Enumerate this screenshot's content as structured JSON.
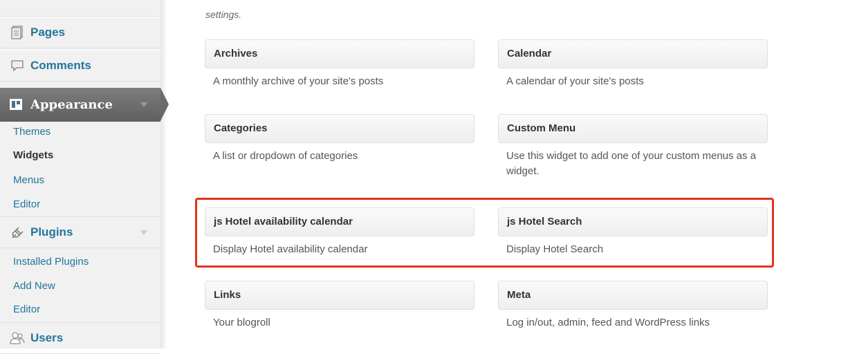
{
  "sidebar": {
    "pages_label": "Pages",
    "comments_label": "Comments",
    "appearance_label": "Appearance",
    "appearance_submenu": [
      "Themes",
      "Widgets",
      "Menus",
      "Editor"
    ],
    "plugins_label": "Plugins",
    "plugins_submenu": [
      "Installed Plugins",
      "Add New",
      "Editor"
    ],
    "users_label": "Users"
  },
  "main": {
    "intro_text": "settings.",
    "widgets": [
      {
        "title": "Archives",
        "description": "A monthly archive of your site's posts"
      },
      {
        "title": "Calendar",
        "description": "A calendar of your site's posts"
      },
      {
        "title": "Categories",
        "description": "A list or dropdown of categories"
      },
      {
        "title": "Custom Menu",
        "description": "Use this widget to add one of your custom menus as a widget."
      },
      {
        "title": "js Hotel availability calendar",
        "description": "Display Hotel availability calendar"
      },
      {
        "title": "js Hotel Search",
        "description": "Display Hotel Search"
      },
      {
        "title": "Links",
        "description": "Your blogroll"
      },
      {
        "title": "Meta",
        "description": "Log in/out, admin, feed and WordPress links"
      }
    ]
  },
  "colors": {
    "link": "#21759b",
    "highlight_border": "#e3321d",
    "active_menu": "#6a6a6a"
  }
}
